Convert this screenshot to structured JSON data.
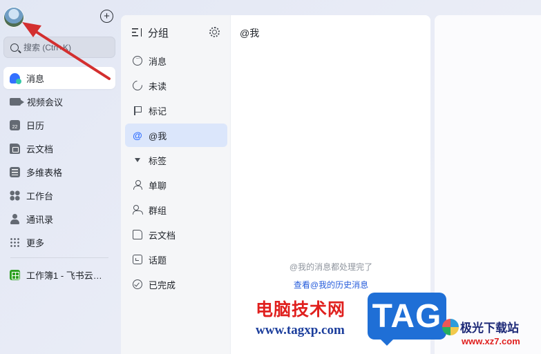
{
  "sidebar": {
    "search_placeholder": "搜索 (Ctrl+K)",
    "items": [
      {
        "label": "消息",
        "icon": "message-icon",
        "active": true
      },
      {
        "label": "视频会议",
        "icon": "video-icon"
      },
      {
        "label": "日历",
        "icon": "calendar-icon",
        "badge": "22"
      },
      {
        "label": "云文档",
        "icon": "cloud-doc-icon"
      },
      {
        "label": "多维表格",
        "icon": "base-table-icon"
      },
      {
        "label": "工作台",
        "icon": "workplace-icon"
      },
      {
        "label": "通讯录",
        "icon": "contacts-icon"
      },
      {
        "label": "更多",
        "icon": "more-icon"
      }
    ],
    "recent": [
      {
        "label": "工作簿1 - 飞书云…",
        "icon": "sheet-icon"
      }
    ]
  },
  "groups": {
    "title": "分组",
    "items": [
      {
        "label": "消息",
        "icon": "chat-bubble-icon"
      },
      {
        "label": "未读",
        "icon": "unread-icon"
      },
      {
        "label": "标记",
        "icon": "flag-icon"
      },
      {
        "label": "@我",
        "icon": "at-icon",
        "active": true
      },
      {
        "label": "标签",
        "icon": "caret-down-icon"
      },
      {
        "label": "单聊",
        "icon": "user-icon"
      },
      {
        "label": "群组",
        "icon": "group-icon"
      },
      {
        "label": "云文档",
        "icon": "doc-icon"
      },
      {
        "label": "话题",
        "icon": "topic-icon"
      },
      {
        "label": "已完成",
        "icon": "done-icon"
      }
    ]
  },
  "main": {
    "title": "@我",
    "empty_text": "@我的消息都处理完了",
    "history_link": "查看@我的历史消息"
  },
  "watermark": {
    "cn_text": "电脑技术网",
    "url": "www.tagxp.com",
    "tag": "TAG",
    "site_name": "极光下载站",
    "site_url": "www.xz7.com"
  },
  "colors": {
    "accent": "#3370ff",
    "active_group_bg": "#dbe6fb",
    "link": "#245bdb",
    "arrow": "#d32f2f"
  }
}
